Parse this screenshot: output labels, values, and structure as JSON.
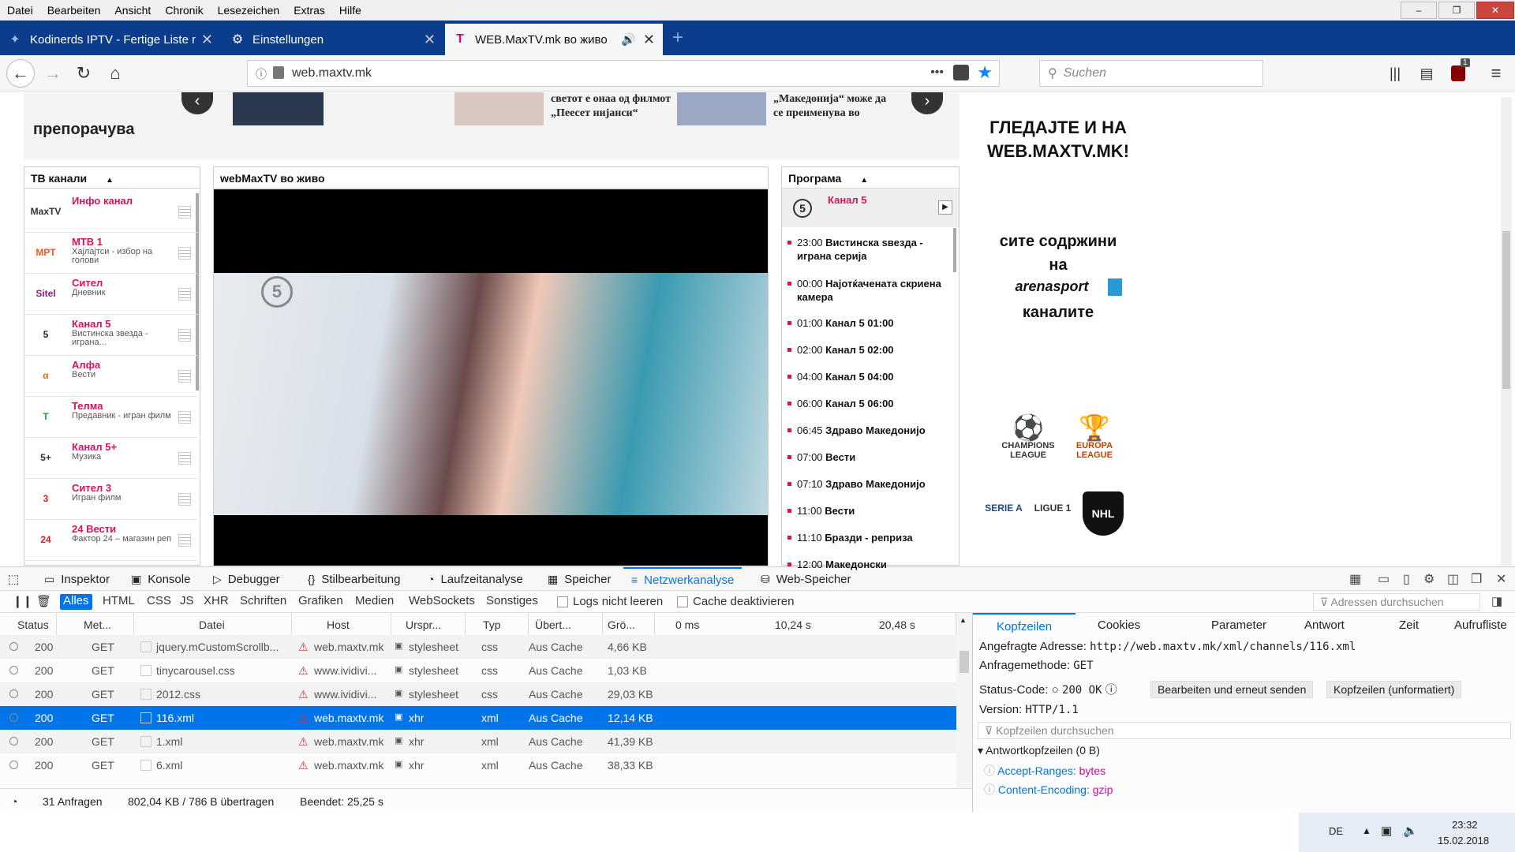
{
  "menu": [
    "Datei",
    "Bearbeiten",
    "Ansicht",
    "Chronik",
    "Lesezeichen",
    "Extras",
    "Hilfe"
  ],
  "window_controls": [
    "–",
    "❐",
    "✕"
  ],
  "tabs": [
    {
      "label": "Kodinerds IPTV - Fertige Liste m",
      "icon": "kodinerds-icon"
    },
    {
      "label": "Einstellungen",
      "icon": "gear-icon"
    },
    {
      "label": "WEB.MaxTV.mk во живо",
      "icon": "telekom-icon",
      "active": true
    }
  ],
  "new_tab": "+",
  "nav": {
    "url_host": "web.maxtv.mk",
    "url_dots": "•••",
    "search_placeholder": "Suchen",
    "addon_badge": "1"
  },
  "page": {
    "overflow_arrow": "»",
    "recommends": "препорачува",
    "news1": "светот е онаа од филмот „Пеесет нијанси“",
    "news2": "„Македонија“ може да се преименува во",
    "ad_title": "ГЛЕДАЈТЕ И НА WEB.MAXTV.MK!",
    "ad_line1": "сите содржини",
    "ad_line2": "на",
    "ad_brand": "arenasport",
    "ad_line3": "каналите",
    "leagues": [
      {
        "name": "CHAMPIONS LEAGUE"
      },
      {
        "name": "EUROPA LEAGUE"
      },
      {
        "name": "SERIE A"
      },
      {
        "name": "LIGUE 1"
      },
      {
        "name": "NHL"
      }
    ],
    "channels_header": "ТВ канали",
    "player_header": "webMaxTV во живо",
    "program_header": "Програма",
    "channels": [
      {
        "logo": "MaxTV",
        "name": "Инфо канал",
        "desc": ""
      },
      {
        "logo": "МРТ",
        "name": "МТВ 1",
        "desc": "Хајлајтси - избор на голови"
      },
      {
        "logo": "Sitel",
        "name": "Сител",
        "desc": "Дневник"
      },
      {
        "logo": "5",
        "name": "Канал 5",
        "desc": "Вистинска звезда - играна..."
      },
      {
        "logo": "α",
        "name": "Алфа",
        "desc": "Вести"
      },
      {
        "logo": "T",
        "name": "Телма",
        "desc": "Предавник - игран филм"
      },
      {
        "logo": "5+",
        "name": "Канал 5+",
        "desc": "Музика"
      },
      {
        "logo": "3",
        "name": "Сител 3",
        "desc": "Игран филм"
      },
      {
        "logo": "24",
        "name": "24 Вести",
        "desc": "Фактор 24 – магазин реп"
      }
    ],
    "program_channel": "Канал 5",
    "program": [
      {
        "time": "23:00",
        "title": "Вистинска ѕвезда - играна серија"
      },
      {
        "time": "00:00",
        "title": "Најотќачената скриена камера"
      },
      {
        "time": "01:00",
        "title": "Канал 5 01:00"
      },
      {
        "time": "02:00",
        "title": "Канал 5 02:00"
      },
      {
        "time": "04:00",
        "title": "Канал 5 04:00"
      },
      {
        "time": "06:00",
        "title": "Канал 5 06:00"
      },
      {
        "time": "06:45",
        "title": "Здраво Македонијо"
      },
      {
        "time": "07:00",
        "title": "Вести"
      },
      {
        "time": "07:10",
        "title": "Здраво Македонијо"
      },
      {
        "time": "11:00",
        "title": "Вести"
      },
      {
        "time": "11:10",
        "title": "Бразди - реприза"
      },
      {
        "time": "12:00",
        "title": "Македонски"
      }
    ]
  },
  "devtools": {
    "tabs": [
      "Inspektor",
      "Konsole",
      "Debugger",
      "Stilbearbeitung",
      "Laufzeitanalyse",
      "Speicher",
      "Netzwerkanalyse",
      "Web-Speicher"
    ],
    "filters": [
      "Alles",
      "HTML",
      "CSS",
      "JS",
      "XHR",
      "Schriften",
      "Grafiken",
      "Medien",
      "WebSockets",
      "Sonstiges"
    ],
    "persist_label": "Logs nicht leeren",
    "cache_label": "Cache deaktivieren",
    "url_filter_placeholder": "Adressen durchsuchen",
    "columns": [
      "Status",
      "Met...",
      "Datei",
      "Host",
      "Urspr...",
      "Typ",
      "Übert...",
      "Grö..."
    ],
    "timeline": [
      "0 ms",
      "10,24 s",
      "20,48 s"
    ],
    "rows": [
      {
        "status": "200",
        "method": "GET",
        "file": "jquery.mCustomScrollb...",
        "host": "web.maxtv.mk",
        "cause": "stylesheet",
        "type": "css",
        "transferred": "Aus Cache",
        "size": "4,66 KB"
      },
      {
        "status": "200",
        "method": "GET",
        "file": "tinycarousel.css",
        "host": "www.ividivi...",
        "cause": "stylesheet",
        "type": "css",
        "transferred": "Aus Cache",
        "size": "1,03 KB"
      },
      {
        "status": "200",
        "method": "GET",
        "file": "2012.css",
        "host": "www.ividivi...",
        "cause": "stylesheet",
        "type": "css",
        "transferred": "Aus Cache",
        "size": "29,03 KB"
      },
      {
        "status": "200",
        "method": "GET",
        "file": "116.xml",
        "host": "web.maxtv.mk",
        "cause": "xhr",
        "type": "xml",
        "transferred": "Aus Cache",
        "size": "12,14 KB",
        "selected": true
      },
      {
        "status": "200",
        "method": "GET",
        "file": "1.xml",
        "host": "web.maxtv.mk",
        "cause": "xhr",
        "type": "xml",
        "transferred": "Aus Cache",
        "size": "41,39 KB"
      },
      {
        "status": "200",
        "method": "GET",
        "file": "6.xml",
        "host": "web.maxtv.mk",
        "cause": "xhr",
        "type": "xml",
        "transferred": "Aus Cache",
        "size": "38,33 KB"
      }
    ],
    "summary": {
      "requests": "31 Anfragen",
      "transferred": "802,04 KB / 786 B übertragen",
      "finished": "Beendet: 25,25 s"
    },
    "detail_tabs": [
      "Kopfzeilen",
      "Cookies",
      "Parameter",
      "Antwort",
      "Zeit",
      "Aufrufliste"
    ],
    "detail": {
      "url_label": "Angefragte Adresse:",
      "url": "http://web.maxtv.mk/xml/channels/116.xml",
      "method_label": "Anfragemethode:",
      "method": "GET",
      "status_label": "Status-Code:",
      "status": "200 OK",
      "edit_btn": "Bearbeiten und erneut senden",
      "raw_btn": "Kopfzeilen (unformatiert)",
      "version_label": "Version:",
      "version": "HTTP/1.1",
      "filter_placeholder": "Kopfzeilen durchsuchen",
      "resp_headers": "Antwortkopfzeilen (0 B)",
      "headers": [
        {
          "k": "Accept-Ranges:",
          "v": "bytes"
        },
        {
          "k": "Content-Encoding:",
          "v": "gzip"
        }
      ]
    }
  },
  "taskbar": {
    "lang": "DE",
    "time": "23:32",
    "date": "15.02.2018"
  },
  "colors": {
    "accent": "#0074e8",
    "channel_name": "#d4145a",
    "tabbar": "#0c3c8c"
  }
}
